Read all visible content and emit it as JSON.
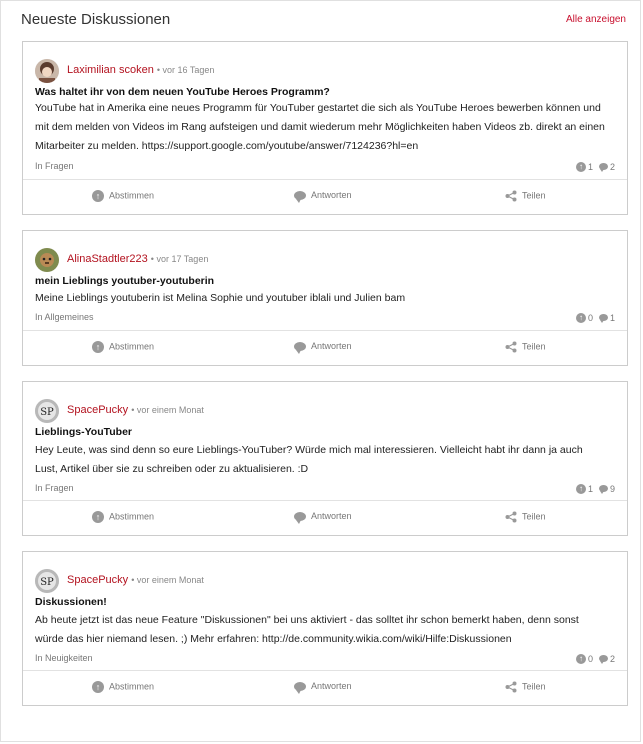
{
  "module": {
    "title": "Neueste Diskussionen",
    "see_all": "Alle anzeigen"
  },
  "actions": {
    "vote": "Abstimmen",
    "reply": "Antworten",
    "share": "Teilen"
  },
  "posts": [
    {
      "author": "Laximilian scoken",
      "time": "vor 16 Tagen",
      "title": "Was haltet ihr von dem neuen YouTube Heroes Programm?",
      "body": "YouTube hat in Amerika eine neues Programm für YouTuber gestartet die sich als YouTube Heroes bewerben können und mit dem melden von Videos im Rang aufsteigen und damit wiederum mehr Möglichkeiten haben Videos zb. direkt an einen Mitarbeiter zu melden. https://support.google.com/youtube/answer/7124236?hl=en",
      "category_prefix": "In",
      "category": "Fragen",
      "upvotes": "1",
      "replies": "2"
    },
    {
      "author": "AlinaStadtler223",
      "time": "vor 17 Tagen",
      "title": "mein Lieblings youtuber-youtuberin",
      "body": "Meine Lieblings youtuberin ist Melina Sophie und youtuber iblali und Julien bam",
      "category_prefix": "In",
      "category": "Allgemeines",
      "upvotes": "0",
      "replies": "1"
    },
    {
      "author": "SpacePucky",
      "time": "vor einem Monat",
      "title": "Lieblings-YouTuber",
      "body": "Hey Leute, was sind denn so eure Lieblings-YouTuber? Würde mich mal interessieren. Vielleicht habt ihr dann ja auch Lust, Artikel über sie zu schreiben oder zu aktualisieren. :D",
      "category_prefix": "In",
      "category": "Fragen",
      "upvotes": "1",
      "replies": "9"
    },
    {
      "author": "SpacePucky",
      "time": "vor einem Monat",
      "title": "Diskussionen!",
      "body": "Ab heute jetzt ist das neue Feature \"Diskussionen\" bei uns aktiviert - das solltet ihr schon bemerkt haben, denn sonst würde das hier niemand lesen. ;) Mehr erfahren: http://de.community.wikia.com/wiki/Hilfe:Diskussionen",
      "category_prefix": "In",
      "category": "Neuigkeiten",
      "upvotes": "0",
      "replies": "2"
    }
  ],
  "colors": {
    "author_link": "#b3121f",
    "border": "#cccccc",
    "muted": "#777777"
  }
}
